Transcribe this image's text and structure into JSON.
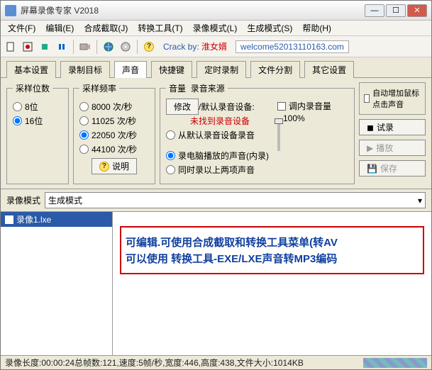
{
  "title": "屏幕录像专家 V2018",
  "menu": [
    "文件(F)",
    "编辑(E)",
    "合成截取(J)",
    "转换工具(T)",
    "录像模式(L)",
    "生成模式(S)",
    "帮助(H)"
  ],
  "toolbar": {
    "crack_prefix": "Crack by:",
    "crack_author": "淮女婿",
    "welcome": "welcome52013110163.com"
  },
  "tabs": [
    "基本设置",
    "录制目标",
    "声音",
    "快捷键",
    "定时录制",
    "文件分割",
    "其它设置"
  ],
  "active_tab": 2,
  "sample_bits": {
    "legend": "采样位数",
    "options": [
      "8位",
      "16位"
    ],
    "selected": 1
  },
  "sample_rate": {
    "legend": "采样频率",
    "options": [
      "8000 次/秒",
      "11025 次/秒",
      "22050 次/秒",
      "44100 次/秒"
    ],
    "selected": 2,
    "help_btn": "说明"
  },
  "volume": {
    "legend": "音量",
    "source_legend": "录音来源",
    "modify": "修改",
    "dev_default": "/默认录音设备:",
    "dev_missing": "未找到录音设备",
    "opts": [
      "从默认录音设备录音",
      "录电脑播放的声音(内录)",
      "同时录以上两项声音"
    ],
    "selected": 1,
    "inner_vol_chk": "调内录音量",
    "inner_vol_val": "100%"
  },
  "auto_group": {
    "chk": "自动增加鼠标点击声音",
    "btns": [
      "试录",
      "播放",
      "保存"
    ]
  },
  "mode": {
    "label": "录像模式",
    "select_label": "生成模式"
  },
  "list_item": "录像1.lxe",
  "red_lines": [
    "可编辑.可使用合成截取和转换工具菜单(转AV",
    "可以使用 转换工具-EXE/LXE声音转MP3编码"
  ],
  "status": "录像长度:00:00:24总帧数:121,速度:5帧/秒,宽度:446,高度:438,文件大小:1014KB"
}
